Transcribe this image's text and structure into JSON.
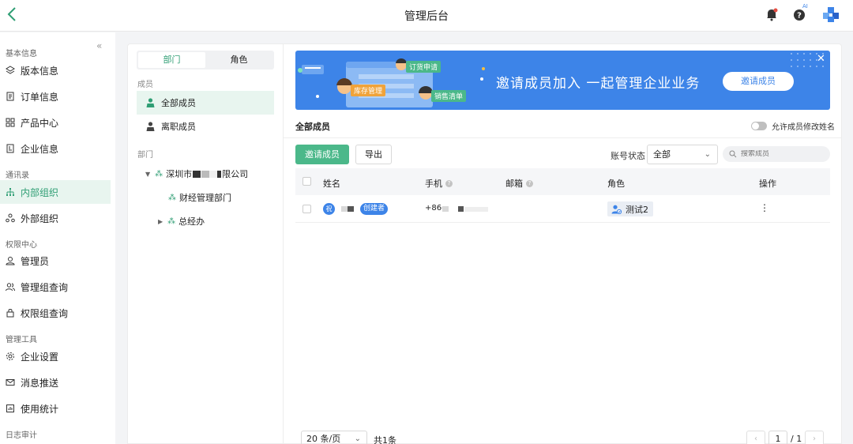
{
  "topbar": {
    "title": "管理后台",
    "icons": [
      "back-icon",
      "bell-icon",
      "help-ai-icon",
      "app-logo"
    ],
    "ai_label": "AI"
  },
  "sidebar": {
    "groups": {
      "basic": "基本信息",
      "contacts": "通讯录",
      "permission": "权限中心",
      "tools": "管理工具",
      "audit": "日志审计"
    },
    "items": [
      {
        "label": "版本信息",
        "icon": "layers-icon"
      },
      {
        "label": "订单信息",
        "icon": "order-icon"
      },
      {
        "label": "产品中心",
        "icon": "grid-icon"
      },
      {
        "label": "企业信息",
        "icon": "building-icon"
      },
      {
        "label": "内部组织",
        "icon": "org-icon",
        "active": true
      },
      {
        "label": "外部组织",
        "icon": "external-org-icon"
      },
      {
        "label": "管理员",
        "icon": "admin-icon"
      },
      {
        "label": "管理组查询",
        "icon": "group-icon"
      },
      {
        "label": "权限组查询",
        "icon": "lock-icon"
      },
      {
        "label": "企业设置",
        "icon": "gear-icon"
      },
      {
        "label": "消息推送",
        "icon": "mail-icon"
      },
      {
        "label": "使用统计",
        "icon": "stats-icon"
      }
    ]
  },
  "member_panel": {
    "tabs": [
      "部门",
      "角色"
    ],
    "members_label": "成员",
    "all_members": "全部成员",
    "left_members": "离职成员",
    "dept_label": "部门",
    "tree": {
      "root_prefix": "深圳市",
      "root_suffix": "限公司",
      "child1": "财经管理部门",
      "child2": "总经办"
    }
  },
  "banner": {
    "title": "邀请成员加入  一起管理企业业务",
    "button": "邀请成员",
    "tags": [
      "订货申请",
      "库存管理",
      "销售清单"
    ],
    "accent": "#3d84e8"
  },
  "main": {
    "section_title": "全部成员",
    "toggle_label": "允许成员修改姓名",
    "invite_button": "邀请成员",
    "export_button": "导出",
    "status_label": "账号状态",
    "status_value": "全部",
    "search_placeholder": "搜索成员",
    "columns": {
      "name": "姓名",
      "phone": "手机",
      "email": "邮箱",
      "role": "角色",
      "action": "操作"
    },
    "rows": [
      {
        "avatar": "祝",
        "badge": "创建者",
        "phone_prefix": "+86-",
        "role": "测试2",
        "action": "⋮"
      }
    ]
  },
  "pager": {
    "page_size": "20 条/页",
    "total": "共1条",
    "current": "1",
    "pages": "/ 1"
  },
  "colors": {
    "primary_green": "#4bb88a",
    "active_bg": "#e8f5ef",
    "brand_blue": "#3d84e8"
  }
}
